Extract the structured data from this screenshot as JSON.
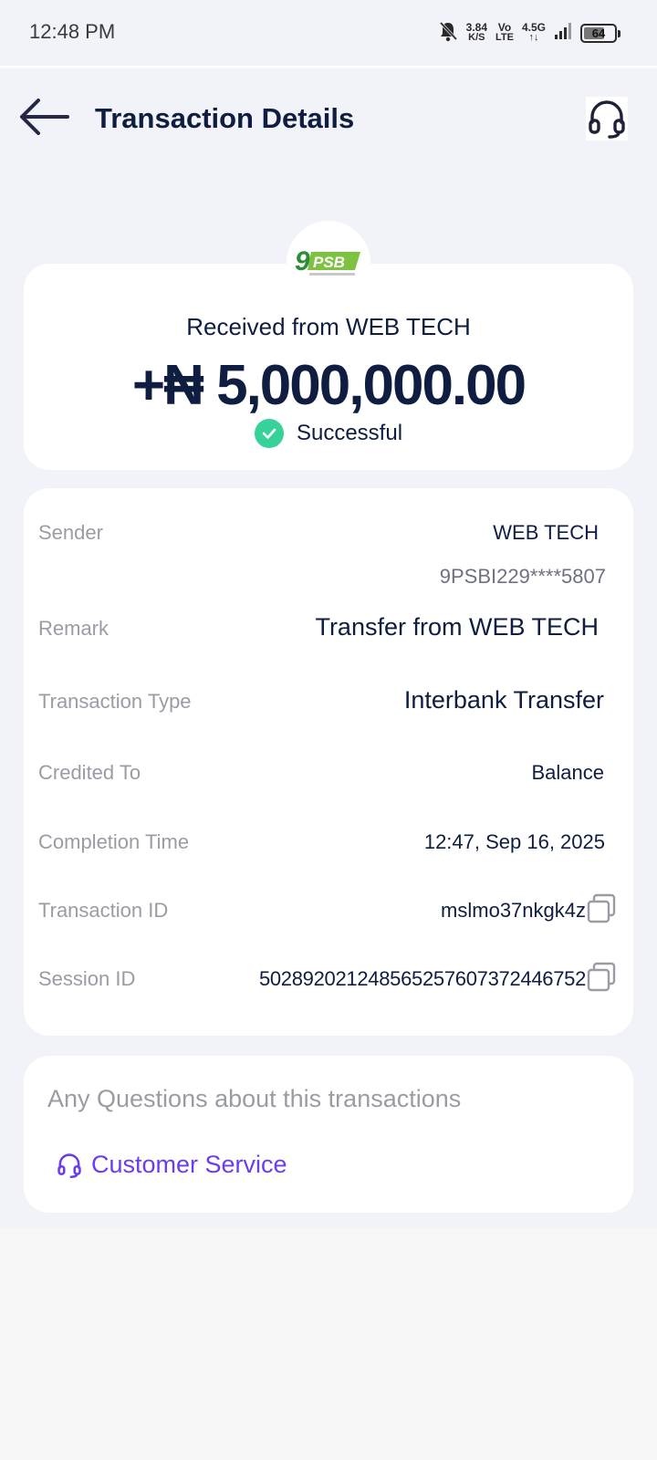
{
  "status_bar": {
    "time": "12:48 PM",
    "net_speed_value": "3.84",
    "net_speed_unit": "K/S",
    "volte_top": "Vo",
    "volte_bottom": "LTE",
    "network_type": "4.5G",
    "network_arrows": "↑↓",
    "battery_level": "64"
  },
  "header": {
    "title": "Transaction Details"
  },
  "bank_logo": {
    "number": "9",
    "letters": "PSB"
  },
  "summary": {
    "received_from": "Received from WEB TECH",
    "amount": "+₦ 5,000,000.00",
    "status": "Successful",
    "status_color": "#36d29a"
  },
  "details": {
    "sender_label": "Sender",
    "sender_name": "WEB TECH",
    "sender_account": "9PSBI229****5807",
    "remark_label": "Remark",
    "remark_value": "Transfer from WEB TECH",
    "type_label": "Transaction Type",
    "type_value": "Interbank Transfer",
    "credited_label": "Credited To",
    "credited_value": "Balance",
    "time_label": "Completion Time",
    "time_value": "12:47, Sep 16, 2025",
    "txn_id_label": "Transaction ID",
    "txn_id_value": "mslmo37nkgk4z",
    "session_label": "Session ID",
    "session_value": "502892021248565257607372446752"
  },
  "help": {
    "question": "Any Questions about this transactions",
    "link_label": "Customer Service",
    "link_color": "#6a3df0"
  },
  "icons": {
    "back": "arrow-left-icon",
    "support": "headset-icon",
    "copy": "copy-icon",
    "check": "check-icon"
  }
}
